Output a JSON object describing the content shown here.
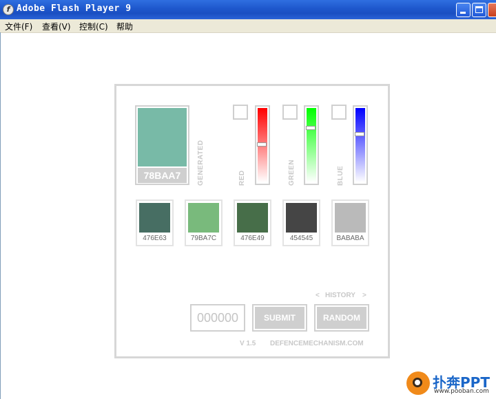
{
  "window": {
    "title": "Adobe Flash Player 9"
  },
  "menu": [
    {
      "label": "文件(F)"
    },
    {
      "label": "查看(V)"
    },
    {
      "label": "控制(C)"
    },
    {
      "label": "帮助"
    }
  ],
  "generated": {
    "label": "GENERATED",
    "hex": "78BAA7",
    "color": "#78BAA7"
  },
  "channels": [
    {
      "label": "RED",
      "color": "#ff0000",
      "level": 0.49
    },
    {
      "label": "GREEN",
      "color": "#00ff00",
      "level": 0.27
    },
    {
      "label": "BLUE",
      "color": "#0000ff",
      "level": 0.35
    }
  ],
  "history_swatches": [
    {
      "hex": "476E63",
      "color": "#476E63"
    },
    {
      "hex": "79BA7C",
      "color": "#79BA7C"
    },
    {
      "hex": "476E49",
      "color": "#476E49"
    },
    {
      "hex": "454545",
      "color": "#454545"
    },
    {
      "hex": "BABABA",
      "color": "#BABABA"
    }
  ],
  "history_nav": {
    "prev": "<",
    "label": "HISTORY",
    "next": ">"
  },
  "input": {
    "value": "000000"
  },
  "buttons": {
    "submit": "SUBMIT",
    "random": "RANDOM"
  },
  "footer": {
    "version": "V 1.5",
    "site": "DEFENCEMECHANISM.COM"
  },
  "watermark": {
    "name": "扑奔PPT",
    "url": "www.pooban.com"
  }
}
